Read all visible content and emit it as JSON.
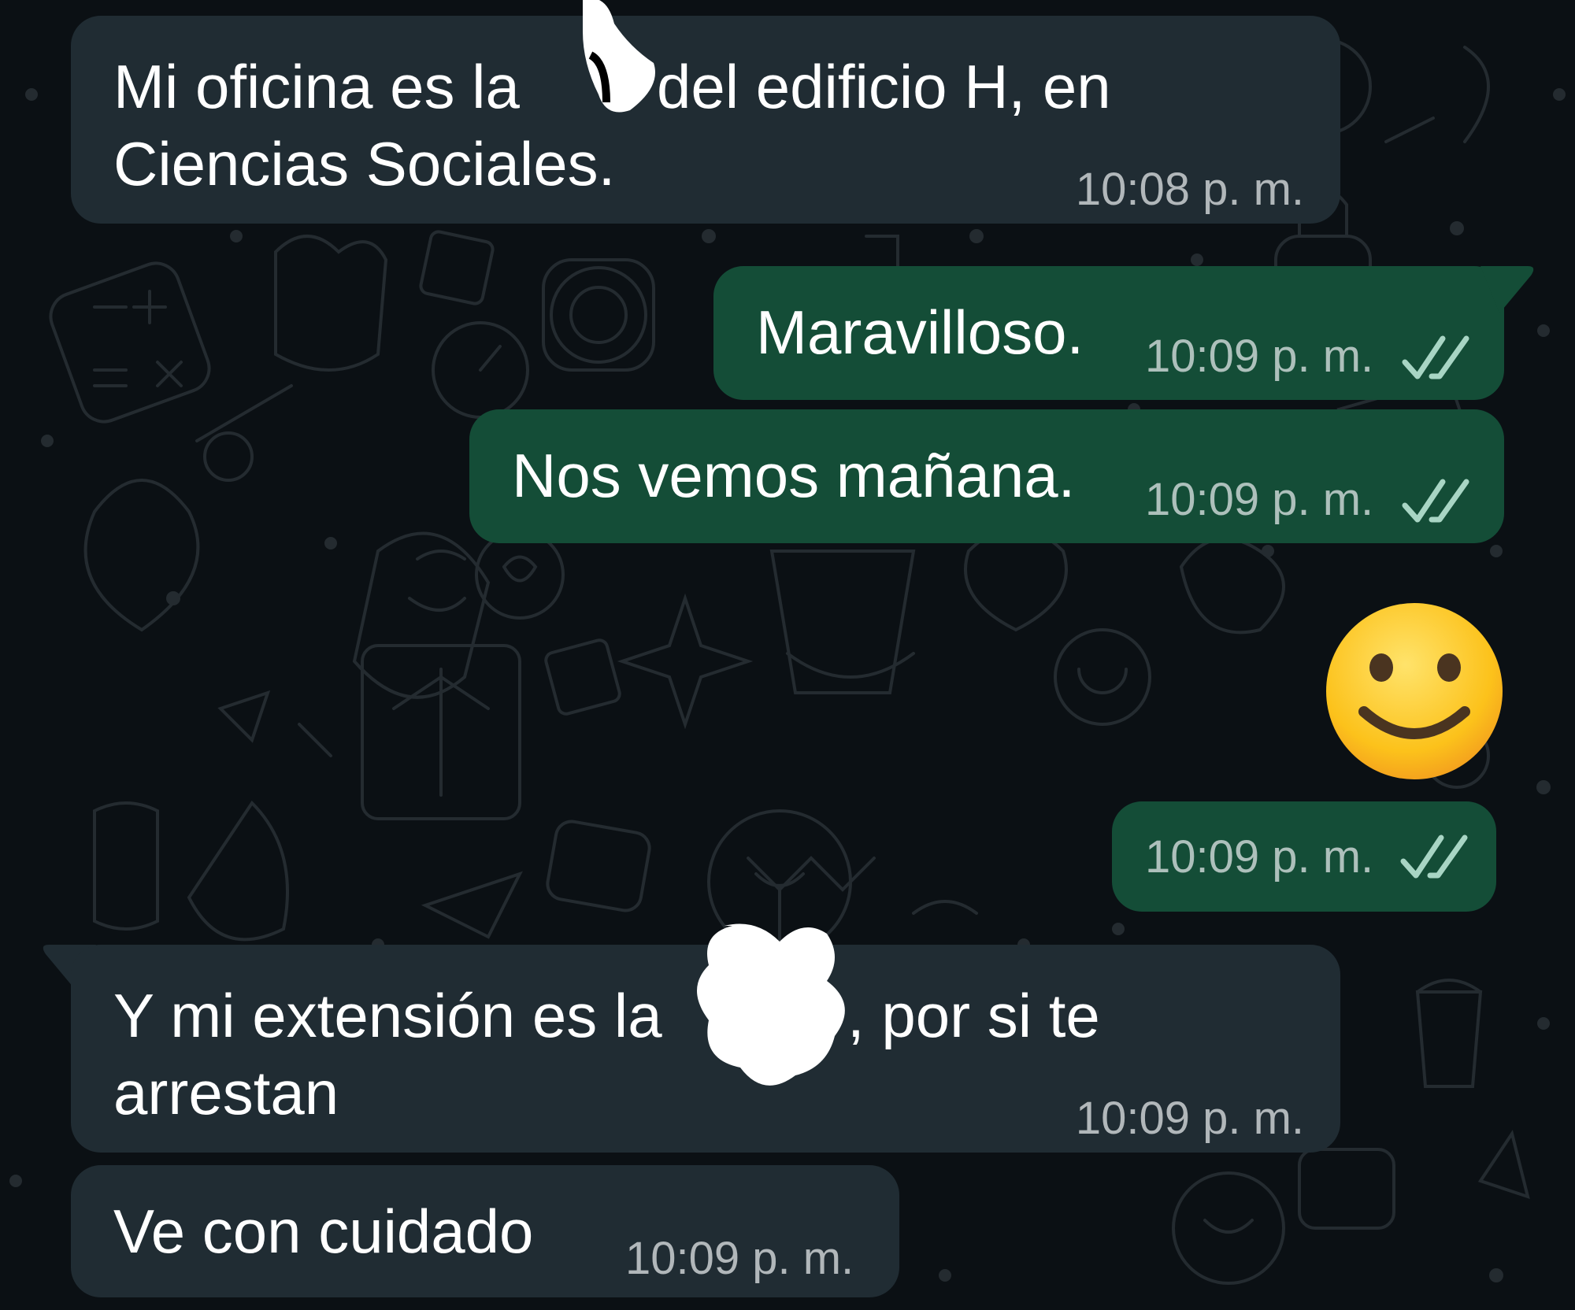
{
  "chat": {
    "colors": {
      "background": "#0b1014",
      "incoming_bubble": "#202c33",
      "outgoing_bubble": "#144d37",
      "read_ticks": "#a8d5c4"
    },
    "messages": [
      {
        "direction": "incoming",
        "line1_a": "Mi oficina es la",
        "line1_b": "del edificio H, en",
        "line2": "Ciencias Sociales.",
        "time": "10:08 p. m."
      },
      {
        "direction": "outgoing",
        "text": "Maravilloso.",
        "time": "10:09 p. m.",
        "status_icon": "double-check-read-icon"
      },
      {
        "direction": "outgoing",
        "text": "Nos vemos mañana.",
        "time": "10:09 p. m.",
        "status_icon": "double-check-read-icon"
      },
      {
        "direction": "outgoing",
        "emoji": "slightly-smiling-face-icon",
        "time": "10:09 p. m.",
        "status_icon": "double-check-read-icon"
      },
      {
        "direction": "incoming",
        "line1_a": "Y mi extensión es la",
        "line1_b": ", por si te",
        "line2": "arrestan",
        "time": "10:09 p. m."
      },
      {
        "direction": "incoming",
        "text": "Ve con cuidado",
        "time": "10:09 p. m."
      }
    ]
  }
}
